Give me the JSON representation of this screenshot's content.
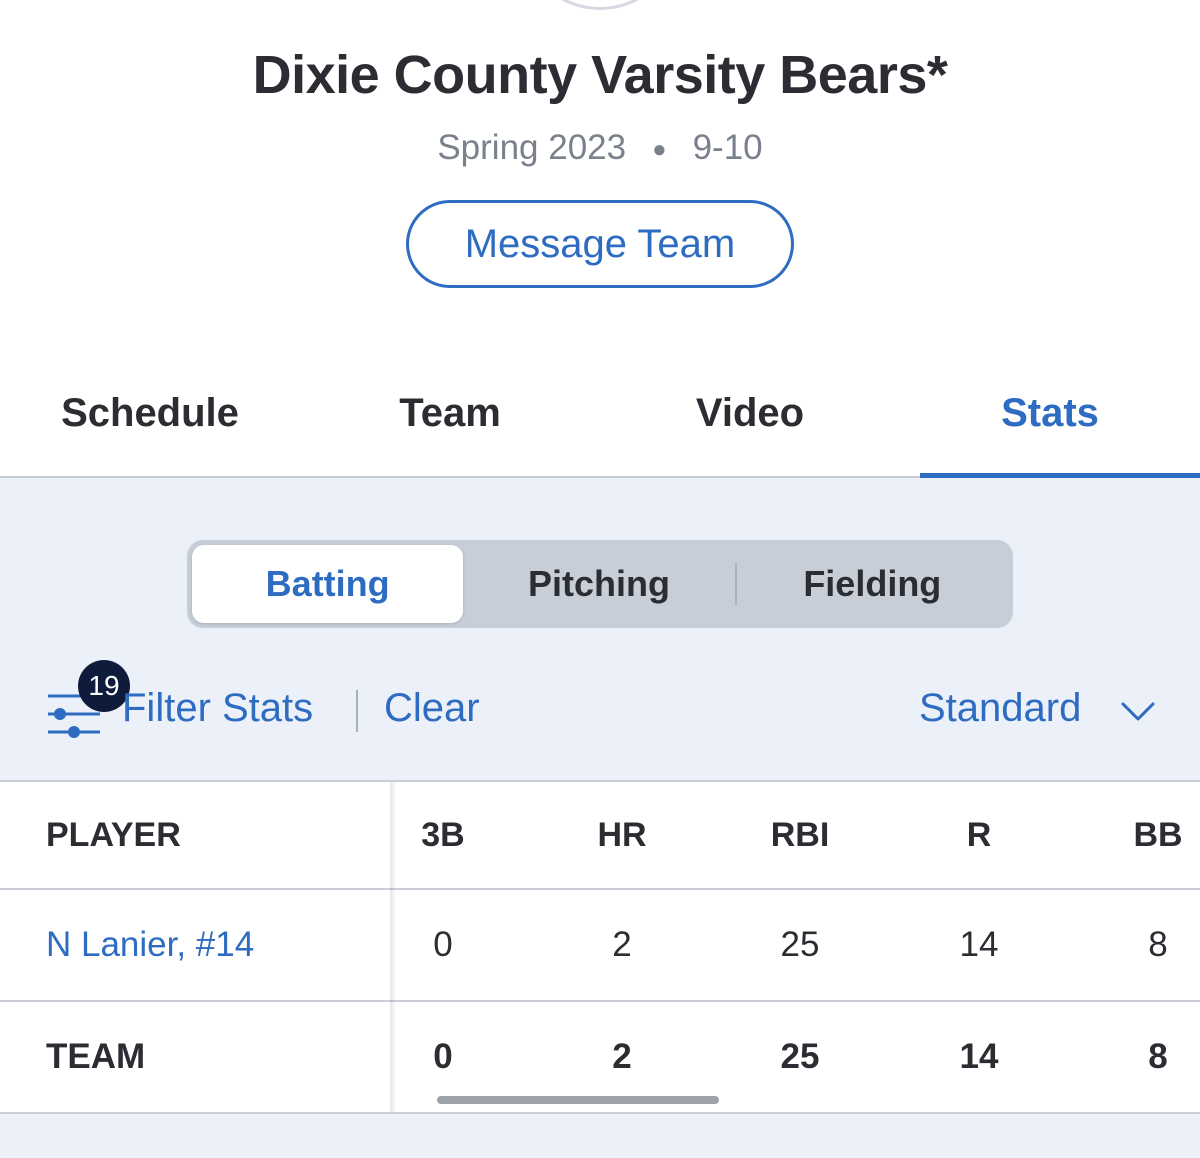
{
  "header": {
    "team_name": "Dixie County Varsity Bears*",
    "season": "Spring 2023",
    "record": "9-10",
    "message_button": "Message Team"
  },
  "tabs": [
    {
      "label": "Schedule"
    },
    {
      "label": "Team"
    },
    {
      "label": "Video"
    },
    {
      "label": "Stats"
    }
  ],
  "segments": [
    {
      "label": "Batting"
    },
    {
      "label": "Pitching"
    },
    {
      "label": "Fielding"
    }
  ],
  "filter": {
    "badge_count": "19",
    "filter_label": "Filter Stats",
    "clear_label": "Clear",
    "view_label": "Standard"
  },
  "table": {
    "columns": [
      "PLAYER",
      "3B",
      "HR",
      "RBI",
      "R",
      "BB"
    ],
    "rows": [
      {
        "player": "N Lanier, #14",
        "values": [
          "0",
          "2",
          "25",
          "14",
          "8"
        ]
      },
      {
        "player": "TEAM",
        "values": [
          "0",
          "2",
          "25",
          "14",
          "8"
        ]
      }
    ]
  },
  "colors": {
    "accent": "#2d6cc0",
    "stats_background": "#ecf1f9",
    "badge": "#0f1b3a"
  }
}
